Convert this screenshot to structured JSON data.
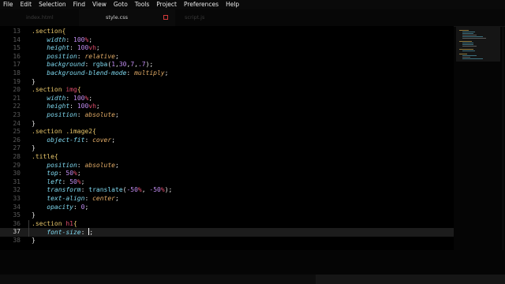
{
  "menu": [
    "File",
    "Edit",
    "Selection",
    "Find",
    "View",
    "Goto",
    "Tools",
    "Project",
    "Preferences",
    "Help"
  ],
  "tabs": [
    {
      "label": "index.html",
      "active": false
    },
    {
      "label": "style.css",
      "active": true
    },
    {
      "label": "script.js",
      "active": false
    }
  ],
  "editor": {
    "line_numbers": [
      "13",
      "14",
      "15",
      "16",
      "17",
      "18",
      "19",
      "20",
      "21",
      "22",
      "23",
      "24",
      "25",
      "26",
      "27",
      "28",
      "29",
      "30",
      "31",
      "32",
      "33",
      "34",
      "35",
      "36",
      "37",
      "38"
    ],
    "current_line": "37",
    "tokens": {
      "l13_sel": ".section{",
      "l14_prop": "width",
      "l14_num": "100",
      "l14_unit": "%",
      "l14_end": ";",
      "l15_prop": "height",
      "l15_num": "100",
      "l15_unit": "vh",
      "l15_end": ";",
      "l16_prop": "position",
      "l16_val": "relative",
      "l16_end": ";",
      "l17_prop": "background",
      "l17_fn": "rgba",
      "l17_open": "(",
      "l17_n1": "1",
      "l17_n2": "30",
      "l17_n3": "7",
      "l17_n4": ".7",
      "l17_comma": ",",
      "l17_close": ");",
      "l18_prop": "background-blend-mode",
      "l18_val": "multiply",
      "l18_end": ";",
      "l19_close": "}",
      "l20_sel": ".section",
      "l20_tag": "img",
      "l20_brace": "{",
      "l21_prop": "width",
      "l21_num": "100",
      "l21_unit": "%",
      "l21_end": ";",
      "l22_prop": "height",
      "l22_num": "100",
      "l22_unit": "vh",
      "l22_end": ";",
      "l23_prop": "position",
      "l23_val": "absolute",
      "l23_end": ";",
      "l24_close": "}",
      "l25_sel": ".section .image2{",
      "l26_prop": "object-fit",
      "l26_val": "cover",
      "l26_end": ";",
      "l27_close": "}",
      "l28_sel": ".title{",
      "l29_prop": "position",
      "l29_val": "absolute",
      "l29_end": ";",
      "l30_prop": "top",
      "l30_num": "50",
      "l30_unit": "%",
      "l30_end": ";",
      "l31_prop": "left",
      "l31_num": "50",
      "l31_unit": "%",
      "l31_end": ";",
      "l32_prop": "transform",
      "l32_fn": "translate",
      "l32_open": "(",
      "l32_n1": "-50",
      "l32_u1": "%",
      "l32_comma": ",",
      "l32_n2": "-50",
      "l32_u2": "%",
      "l32_close": ");",
      "l33_prop": "text-align",
      "l33_val": "center",
      "l33_end": ";",
      "l34_prop": "opacity",
      "l34_num": "0",
      "l34_end": ";",
      "l35_close": "}",
      "l36_sel": ".section",
      "l36_tag": "h1",
      "l36_brace": "{",
      "l37_prop": "font-size",
      "l37_end": ";",
      "l38_close": "}",
      "colon": ":"
    }
  },
  "colors": {
    "background": "#000000",
    "selector": "#e8c66a",
    "property": "#7fd8ef",
    "number": "#c08cf0",
    "unit": "#e04e6e",
    "keyword_value": "#e0aa66",
    "close_icon": "#d13a3a"
  },
  "icons": {
    "tab_close": "close-icon"
  }
}
